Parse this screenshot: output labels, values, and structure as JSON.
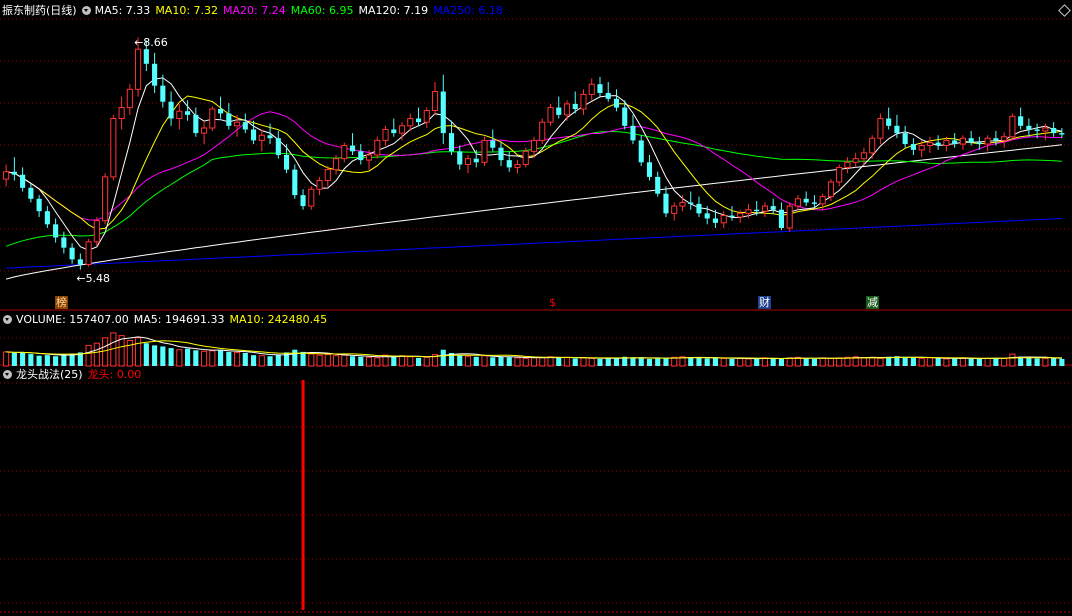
{
  "main_panel": {
    "title": "振东制药(日线)",
    "indicators": [
      {
        "label": "MA5: 7.33",
        "color": "#ffffff"
      },
      {
        "label": "MA10: 7.32",
        "color": "#ffff00"
      },
      {
        "label": "MA20: 7.24",
        "color": "#ff00ff"
      },
      {
        "label": "MA60: 6.95",
        "color": "#00ff00"
      },
      {
        "label": "MA120: 7.19",
        "color": "#ffffff"
      },
      {
        "label": "MA250: 6.18",
        "color": "#0000ff"
      }
    ],
    "high_label": "8.66",
    "low_label": "5.48",
    "events": [
      {
        "text": "榜",
        "color": "#ff8c00"
      },
      {
        "text": "$",
        "color": "#ff0000"
      },
      {
        "text": "财",
        "color": "#00bfff"
      },
      {
        "text": "减",
        "color": "#00ff00"
      }
    ]
  },
  "volume_panel": {
    "indicators": [
      {
        "label": "VOLUME: 157407.00",
        "color": "#ffffff"
      },
      {
        "label": "MA5: 194691.33",
        "color": "#ffffff"
      },
      {
        "label": "MA10: 242480.45",
        "color": "#ffff00"
      }
    ]
  },
  "sub_panel": {
    "title": "龙头战法(25)",
    "indicator_label": "龙头: 0.00",
    "indicator_color": "#ff0000"
  },
  "colors": {
    "up": "#ff3232",
    "down": "#54ffff",
    "grid": "#8b0000",
    "ma5": "#ffffff",
    "ma10": "#ffff00",
    "ma20": "#ff00ff",
    "ma60": "#00ff00",
    "ma120": "#ffffff",
    "ma250": "#0000ff"
  },
  "chart_data": {
    "type": "candlestick",
    "y_range": [
      5.2,
      8.9
    ],
    "ohlc": [
      [
        6.72,
        6.92,
        6.62,
        6.82
      ],
      [
        6.82,
        7.02,
        6.7,
        6.78
      ],
      [
        6.78,
        6.88,
        6.55,
        6.6
      ],
      [
        6.6,
        6.66,
        6.4,
        6.45
      ],
      [
        6.45,
        6.5,
        6.2,
        6.28
      ],
      [
        6.28,
        6.35,
        6.05,
        6.1
      ],
      [
        6.1,
        6.18,
        5.85,
        5.92
      ],
      [
        5.92,
        6.0,
        5.7,
        5.78
      ],
      [
        5.78,
        5.84,
        5.56,
        5.62
      ],
      [
        5.62,
        5.7,
        5.48,
        5.55
      ],
      [
        5.55,
        5.9,
        5.52,
        5.86
      ],
      [
        5.86,
        6.2,
        5.8,
        6.15
      ],
      [
        6.15,
        6.8,
        6.1,
        6.75
      ],
      [
        6.75,
        7.6,
        6.7,
        7.55
      ],
      [
        7.55,
        7.85,
        7.4,
        7.7
      ],
      [
        7.7,
        8.02,
        7.6,
        7.95
      ],
      [
        7.95,
        8.66,
        7.85,
        8.5
      ],
      [
        8.5,
        8.62,
        8.2,
        8.3
      ],
      [
        8.3,
        8.45,
        7.9,
        8.0
      ],
      [
        8.0,
        8.15,
        7.7,
        7.78
      ],
      [
        7.78,
        7.92,
        7.45,
        7.55
      ],
      [
        7.55,
        7.75,
        7.4,
        7.65
      ],
      [
        7.65,
        7.8,
        7.52,
        7.6
      ],
      [
        7.6,
        7.7,
        7.3,
        7.35
      ],
      [
        7.35,
        7.5,
        7.2,
        7.42
      ],
      [
        7.42,
        7.72,
        7.38,
        7.68
      ],
      [
        7.68,
        7.85,
        7.55,
        7.62
      ],
      [
        7.62,
        7.76,
        7.4,
        7.45
      ],
      [
        7.45,
        7.6,
        7.3,
        7.5
      ],
      [
        7.5,
        7.62,
        7.35,
        7.4
      ],
      [
        7.4,
        7.52,
        7.2,
        7.25
      ],
      [
        7.25,
        7.4,
        7.1,
        7.32
      ],
      [
        7.32,
        7.48,
        7.2,
        7.28
      ],
      [
        7.28,
        7.38,
        7.0,
        7.05
      ],
      [
        7.05,
        7.2,
        6.8,
        6.85
      ],
      [
        6.85,
        6.92,
        6.45,
        6.5
      ],
      [
        6.5,
        6.58,
        6.3,
        6.35
      ],
      [
        6.35,
        6.62,
        6.3,
        6.58
      ],
      [
        6.58,
        6.75,
        6.5,
        6.7
      ],
      [
        6.7,
        6.9,
        6.62,
        6.85
      ],
      [
        6.85,
        7.05,
        6.78,
        7.0
      ],
      [
        7.0,
        7.22,
        6.95,
        7.18
      ],
      [
        7.18,
        7.35,
        7.05,
        7.1
      ],
      [
        7.1,
        7.2,
        6.92,
        6.98
      ],
      [
        6.98,
        7.12,
        6.85,
        7.05
      ],
      [
        7.05,
        7.3,
        7.0,
        7.25
      ],
      [
        7.25,
        7.45,
        7.18,
        7.4
      ],
      [
        7.4,
        7.55,
        7.3,
        7.35
      ],
      [
        7.35,
        7.5,
        7.25,
        7.45
      ],
      [
        7.45,
        7.62,
        7.38,
        7.55
      ],
      [
        7.55,
        7.7,
        7.45,
        7.5
      ],
      [
        7.5,
        7.7,
        7.42,
        7.66
      ],
      [
        7.66,
        8.05,
        7.6,
        7.92
      ],
      [
        7.92,
        8.15,
        7.2,
        7.35
      ],
      [
        7.35,
        7.52,
        7.05,
        7.1
      ],
      [
        7.1,
        7.18,
        6.85,
        6.92
      ],
      [
        6.92,
        7.05,
        6.8,
        7.0
      ],
      [
        7.0,
        7.12,
        6.88,
        6.95
      ],
      [
        6.95,
        7.3,
        6.9,
        7.25
      ],
      [
        7.25,
        7.4,
        7.1,
        7.15
      ],
      [
        7.15,
        7.22,
        6.9,
        6.98
      ],
      [
        6.98,
        7.1,
        6.82,
        6.88
      ],
      [
        6.88,
        6.98,
        6.8,
        6.92
      ],
      [
        6.92,
        7.15,
        6.88,
        7.1
      ],
      [
        7.1,
        7.3,
        7.02,
        7.25
      ],
      [
        7.25,
        7.55,
        7.2,
        7.5
      ],
      [
        7.5,
        7.75,
        7.45,
        7.7
      ],
      [
        7.7,
        7.85,
        7.55,
        7.6
      ],
      [
        7.6,
        7.8,
        7.52,
        7.75
      ],
      [
        7.75,
        7.92,
        7.62,
        7.68
      ],
      [
        7.68,
        7.95,
        7.6,
        7.88
      ],
      [
        7.88,
        8.1,
        7.8,
        8.02
      ],
      [
        8.02,
        8.12,
        7.85,
        7.9
      ],
      [
        7.9,
        8.05,
        7.78,
        7.82
      ],
      [
        7.82,
        7.95,
        7.65,
        7.7
      ],
      [
        7.7,
        7.8,
        7.4,
        7.45
      ],
      [
        7.45,
        7.6,
        7.2,
        7.25
      ],
      [
        7.25,
        7.32,
        6.9,
        6.95
      ],
      [
        6.95,
        7.05,
        6.7,
        6.75
      ],
      [
        6.75,
        6.82,
        6.48,
        6.52
      ],
      [
        6.52,
        6.62,
        6.2,
        6.25
      ],
      [
        6.25,
        6.4,
        6.15,
        6.35
      ],
      [
        6.35,
        6.5,
        6.28,
        6.4
      ],
      [
        6.4,
        6.55,
        6.3,
        6.38
      ],
      [
        6.38,
        6.48,
        6.2,
        6.25
      ],
      [
        6.25,
        6.35,
        6.1,
        6.18
      ],
      [
        6.18,
        6.3,
        6.05,
        6.12
      ],
      [
        6.12,
        6.28,
        6.05,
        6.22
      ],
      [
        6.22,
        6.35,
        6.15,
        6.2
      ],
      [
        6.2,
        6.3,
        6.12,
        6.25
      ],
      [
        6.25,
        6.38,
        6.18,
        6.3
      ],
      [
        6.3,
        6.42,
        6.22,
        6.28
      ],
      [
        6.28,
        6.4,
        6.2,
        6.35
      ],
      [
        6.35,
        6.45,
        6.25,
        6.3
      ],
      [
        6.3,
        6.4,
        6.02,
        6.05
      ],
      [
        6.05,
        6.4,
        6.0,
        6.35
      ],
      [
        6.35,
        6.5,
        6.3,
        6.45
      ],
      [
        6.45,
        6.55,
        6.35,
        6.4
      ],
      [
        6.4,
        6.5,
        6.32,
        6.38
      ],
      [
        6.38,
        6.52,
        6.3,
        6.48
      ],
      [
        6.48,
        6.72,
        6.42,
        6.68
      ],
      [
        6.68,
        6.92,
        6.62,
        6.88
      ],
      [
        6.88,
        7.02,
        6.8,
        6.95
      ],
      [
        6.95,
        7.08,
        6.88,
        7.0
      ],
      [
        7.0,
        7.15,
        6.9,
        7.08
      ],
      [
        7.08,
        7.32,
        7.0,
        7.28
      ],
      [
        7.28,
        7.62,
        7.2,
        7.55
      ],
      [
        7.55,
        7.7,
        7.4,
        7.45
      ],
      [
        7.45,
        7.6,
        7.28,
        7.35
      ],
      [
        7.35,
        7.45,
        7.15,
        7.2
      ],
      [
        7.2,
        7.28,
        7.05,
        7.12
      ],
      [
        7.12,
        7.25,
        7.02,
        7.18
      ],
      [
        7.18,
        7.3,
        7.08,
        7.22
      ],
      [
        7.22,
        7.32,
        7.12,
        7.18
      ],
      [
        7.18,
        7.3,
        7.1,
        7.25
      ],
      [
        7.25,
        7.35,
        7.15,
        7.2
      ],
      [
        7.2,
        7.32,
        7.12,
        7.28
      ],
      [
        7.28,
        7.38,
        7.18,
        7.22
      ],
      [
        7.22,
        7.3,
        7.12,
        7.2
      ],
      [
        7.2,
        7.32,
        7.1,
        7.28
      ],
      [
        7.28,
        7.38,
        7.18,
        7.25
      ],
      [
        7.25,
        7.36,
        7.15,
        7.3
      ],
      [
        7.3,
        7.62,
        7.25,
        7.58
      ],
      [
        7.58,
        7.7,
        7.4,
        7.45
      ],
      [
        7.45,
        7.55,
        7.3,
        7.4
      ],
      [
        7.4,
        7.48,
        7.28,
        7.38
      ],
      [
        7.38,
        7.48,
        7.25,
        7.42
      ],
      [
        7.42,
        7.5,
        7.3,
        7.35
      ],
      [
        7.35,
        7.42,
        7.28,
        7.33
      ]
    ],
    "volume": [
      260,
      240,
      250,
      220,
      190,
      200,
      180,
      210,
      230,
      250,
      380,
      420,
      520,
      610,
      560,
      470,
      520,
      420,
      380,
      360,
      330,
      300,
      320,
      290,
      270,
      280,
      300,
      260,
      250,
      240,
      200,
      190,
      180,
      210,
      250,
      300,
      260,
      220,
      200,
      210,
      190,
      200,
      180,
      170,
      160,
      150,
      200,
      180,
      190,
      170,
      150,
      160,
      210,
      300,
      240,
      200,
      180,
      170,
      190,
      160,
      170,
      160,
      150,
      140,
      150,
      160,
      170,
      150,
      160,
      140,
      150,
      140,
      130,
      150,
      140,
      170,
      160,
      150,
      130,
      140,
      150,
      160,
      170,
      160,
      150,
      140,
      150,
      140,
      130,
      140,
      130,
      140,
      150,
      140,
      130,
      150,
      160,
      140,
      130,
      150,
      140,
      150,
      160,
      170,
      150,
      160,
      140,
      170,
      180,
      160,
      150,
      140,
      150,
      140,
      130,
      140,
      150,
      140,
      130,
      140,
      150,
      140,
      220,
      170,
      150,
      140,
      140,
      150,
      130
    ],
    "volume_range": [
      0,
      700
    ],
    "longtou": {
      "y_range": [
        0,
        1
      ],
      "spike_index": 36,
      "spike_value": 1
    }
  }
}
